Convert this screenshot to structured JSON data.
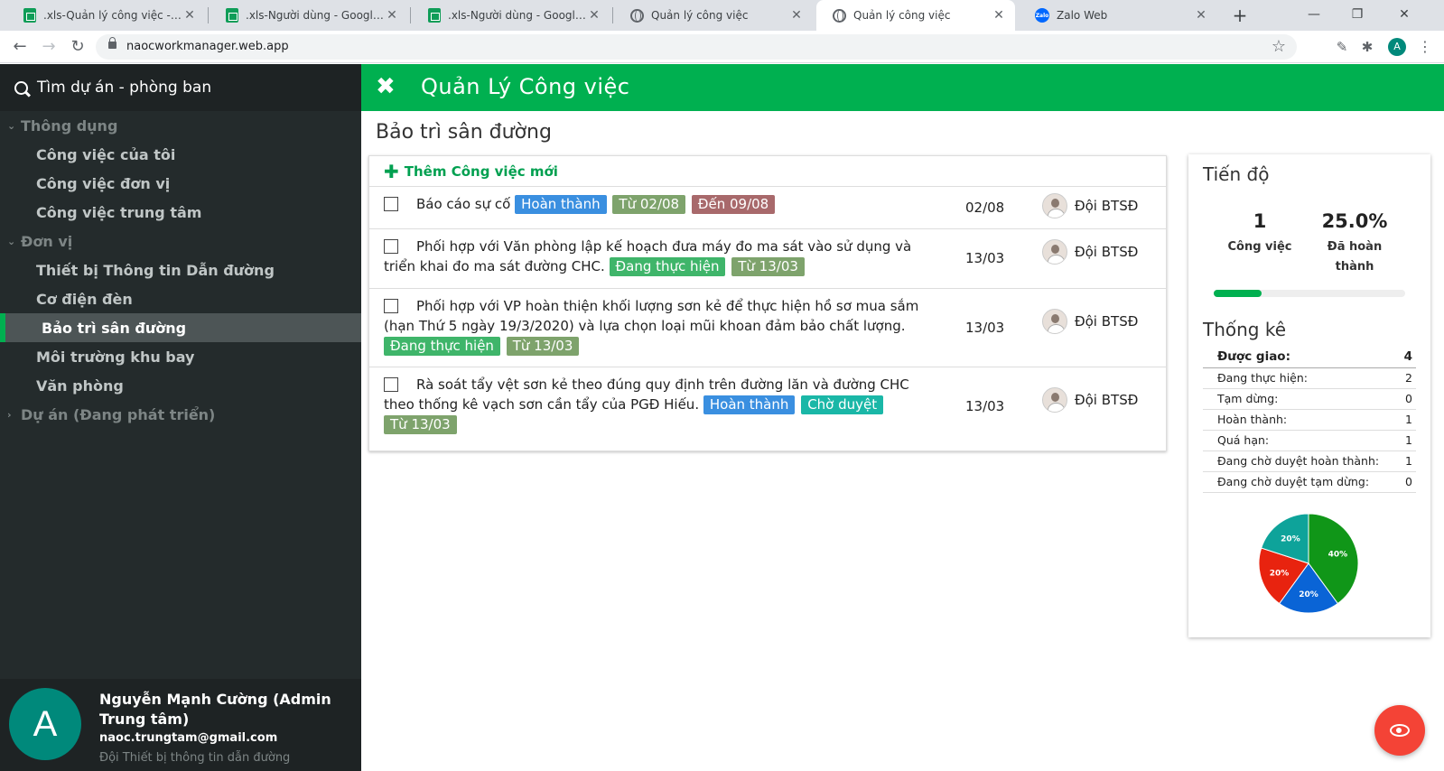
{
  "browser": {
    "tabs": [
      {
        "title": ".xls-Quản lý công việc - Google",
        "icon": "sheets-icon",
        "active": false
      },
      {
        "title": ".xls-Người dùng - Google Shee",
        "icon": "sheets-icon",
        "active": false
      },
      {
        "title": ".xls-Người dùng - Google Shee",
        "icon": "sheets-icon",
        "active": false
      },
      {
        "title": "Quản lý công việc",
        "icon": "globe-icon",
        "active": false
      },
      {
        "title": "Quản lý công việc",
        "icon": "globe-icon",
        "active": true
      },
      {
        "title": "Zalo Web",
        "icon": "zalo-icon",
        "active": false
      }
    ],
    "tab_close": "✕",
    "new_tab": "+",
    "url": "naocworkmanager.web.app",
    "profile_initial": "A",
    "zalo_label": "Zalo"
  },
  "sidebar": {
    "search_label": "Tìm dự án - phòng ban",
    "groups": [
      {
        "label": "Thông dụng",
        "expanded": true,
        "items": [
          "Công việc của tôi",
          "Công việc đơn vị",
          "Công việc trung tâm"
        ]
      },
      {
        "label": "Đơn vị",
        "expanded": true,
        "items": [
          "Thiết bị Thông tin Dẫn đường",
          "Cơ điện đèn",
          "Bảo trì sân đường",
          "Môi trường khu bay",
          "Văn phòng"
        ]
      },
      {
        "label": "Dự án (Đang phát triển)",
        "expanded": false,
        "items": []
      }
    ],
    "active_item": "Bảo trì sân đường",
    "user": {
      "initial": "A",
      "name": "Nguyễn Mạnh Cường (Admin Trung tâm)",
      "email": "naoc.trungtam@gmail.com",
      "dept": "Đội Thiết bị thông tin dẫn đường"
    }
  },
  "header": {
    "title": "Quản Lý Công việc"
  },
  "main": {
    "page_title": "Bảo trì sân đường",
    "add_task_label": "Thêm Công việc mới",
    "tasks": [
      {
        "text": "Báo cáo sự cố",
        "badges": [
          {
            "label": "Hoàn thành",
            "color": "blue"
          },
          {
            "label": "Từ 02/08",
            "color": "olive"
          },
          {
            "label": "Đến 09/08",
            "color": "brown"
          }
        ],
        "date": "02/08",
        "assignee": "Đội BTSĐ"
      },
      {
        "text": "Phối hợp với Văn phòng lập kế hoạch đưa máy đo ma sát vào sử dụng và triển khai đo ma sát đường CHC.",
        "badges": [
          {
            "label": "Đang thực hiện",
            "color": "green"
          },
          {
            "label": "Từ 13/03",
            "color": "olive"
          }
        ],
        "date": "13/03",
        "assignee": "Đội BTSĐ"
      },
      {
        "text": "Phối hợp với VP hoàn thiện khối lượng sơn kẻ để thực hiện hồ sơ mua sắm (hạn Thứ 5 ngày 19/3/2020) và lựa chọn loại mũi khoan đảm bảo chất lượng.",
        "badges": [
          {
            "label": "Đang thực hiện",
            "color": "green"
          },
          {
            "label": "Từ 13/03",
            "color": "olive"
          }
        ],
        "date": "13/03",
        "assignee": "Đội BTSĐ"
      },
      {
        "text": "Rà soát tẩy vệt sơn kẻ theo đúng quy định trên đường lăn và đường CHC theo thống kê vạch sơn cần tẩy của PGĐ Hiếu.",
        "badges": [
          {
            "label": "Hoàn thành",
            "color": "blue"
          },
          {
            "label": "Chờ duyệt",
            "color": "teal"
          },
          {
            "label": "Từ 13/03",
            "color": "olive"
          }
        ],
        "date": "13/03",
        "assignee": "Đội BTSĐ"
      }
    ]
  },
  "progress": {
    "title": "Tiến độ",
    "tasks_value": "1",
    "tasks_label": "Công việc",
    "done_value": "25.0%",
    "done_label": "Đã hoàn thành",
    "done_fraction": 0.25
  },
  "stats": {
    "title": "Thống kê",
    "rows": [
      {
        "label": "Được giao:",
        "value": "4"
      },
      {
        "label": "Đang thực hiện:",
        "value": "2"
      },
      {
        "label": "Tạm dừng:",
        "value": "0"
      },
      {
        "label": "Hoàn thành:",
        "value": "1"
      },
      {
        "label": "Quá hạn:",
        "value": "1"
      },
      {
        "label": "Đang chờ duyệt hoàn thành:",
        "value": "1"
      },
      {
        "label": "Đang chờ duyệt tạm dừng:",
        "value": "0"
      }
    ]
  },
  "chart_data": {
    "type": "pie",
    "slices": [
      {
        "label": "40%",
        "value": 40,
        "color": "#109618"
      },
      {
        "label": "20%",
        "value": 20,
        "color": "#0a64d6"
      },
      {
        "label": "20%",
        "value": 20,
        "color": "#e8230f"
      },
      {
        "label": "20%",
        "value": 20,
        "color": "#0ea39a"
      }
    ]
  }
}
